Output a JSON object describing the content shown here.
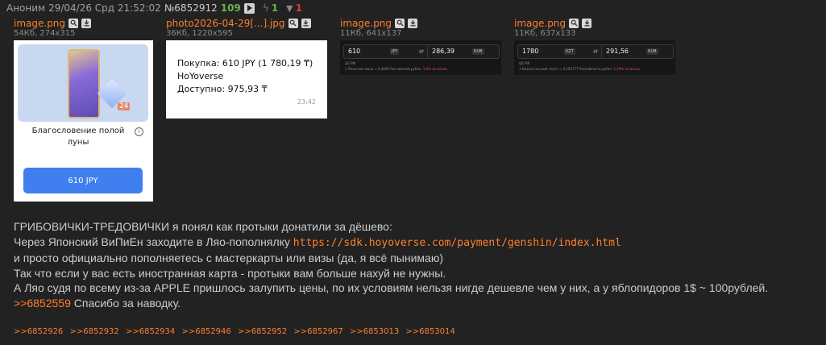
{
  "header": {
    "name": "Аноним",
    "date": "29/04/26 Срд 21:52:02",
    "post_number": "№6852912",
    "count": "109",
    "likes": "1",
    "dislikes": "1"
  },
  "files": [
    {
      "name": "image.png",
      "meta": "54Кб, 274x315"
    },
    {
      "name": "photo2026-04-29[...].jpg",
      "meta": "36Кб, 1220x595"
    },
    {
      "name": "image.png",
      "meta": "11Кб, 641x137"
    },
    {
      "name": "image.png",
      "meta": "11Кб, 637x133"
    }
  ],
  "thumb1": {
    "badge": "24",
    "title": "Благословение полой луны",
    "price_button": "610 JPY"
  },
  "thumb2": {
    "line1": "Покупка: 610 JPY (1 780,19 ₸)",
    "line2": "HoYoverse",
    "line3": "Доступно: 975,93 ₸",
    "time": "23:42"
  },
  "thumb3": {
    "amount": "610",
    "from_cur": "JPY",
    "result": "286,39",
    "to_cur": "RUB",
    "small1": "ЦБ РФ",
    "small2": "1 Японская йена = 0,4695 Российский рубль",
    "small2_change": "-1,6% за месяц"
  },
  "thumb4": {
    "amount": "1780",
    "from_cur": "KZT",
    "result": "291,56",
    "to_cur": "RUB",
    "small1": "ЦБ РФ",
    "small2": "1 Казахстанский тенге = 0,163777 Российского рубля",
    "small2_change": "-2,19% за месяц"
  },
  "post": {
    "line1": "ГРИБОВИЧКИ-ТРЕДОВИЧКИ я понял как протыки донатили за дёшево:",
    "line2_text": "Через Японский ВиПиЕн заходите в Ляо-пополнялку ",
    "line2_link": "https://sdk.hoyoverse.com/payment/genshin/index.html",
    "line3": "и просто официально пополняетесь с мастеркарты или визы (да, я всё пынимаю)",
    "line4": "Так что если у вас есть иностранная карта - протыки вам больше нахуй не нужны.",
    "line5": "А Ляо судя по всему из-за APPLE пришлось залупить цены, по их условиям нельзя нигде дешевле чем у них, а у яблопидоров 1$ ~ 100рублей.",
    "line6_link": ">>6852559",
    "line6_text": " Спасибо за наводку."
  },
  "replies": [
    ">>6852926",
    ">>6852932",
    ">>6852934",
    ">>6852946",
    ">>6852952",
    ">>6852967",
    ">>6853013",
    ">>6853014"
  ],
  "colors": {
    "link": "#ff7f2a",
    "background": "#222222",
    "likes": "#6fb04c",
    "dislikes": "#d93b3b"
  }
}
